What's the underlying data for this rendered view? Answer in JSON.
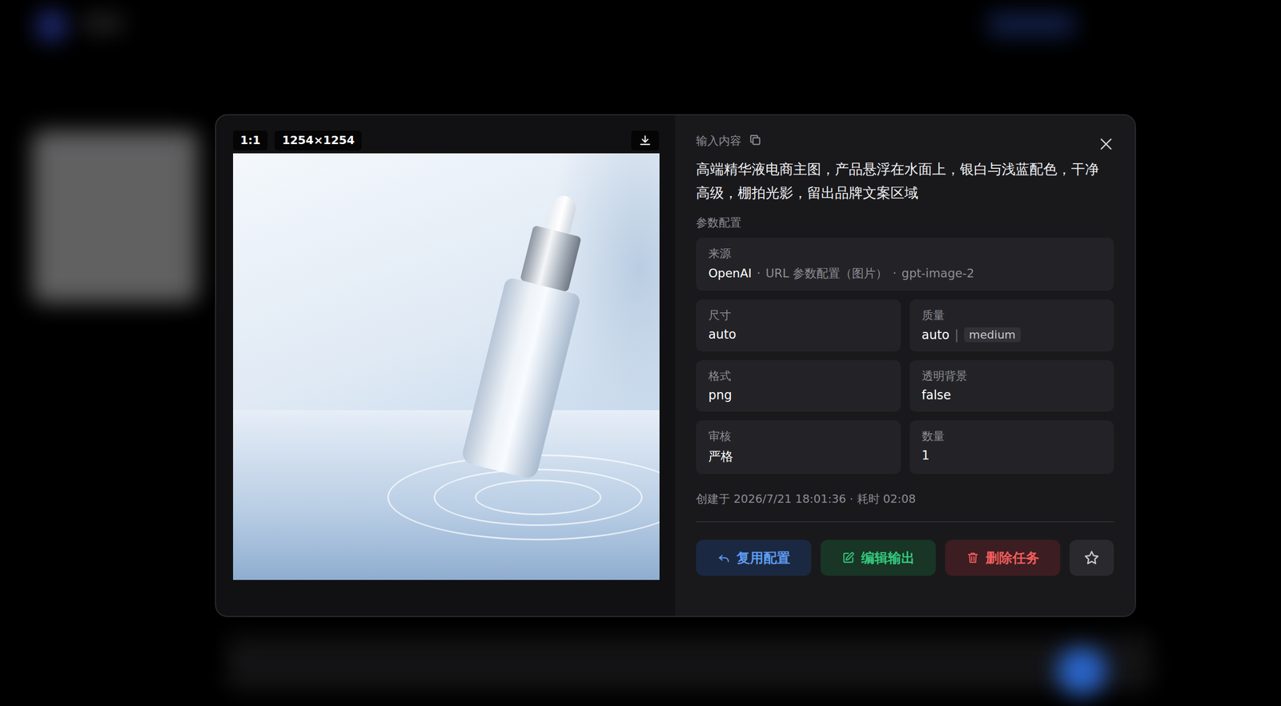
{
  "image": {
    "aspect": "1:1",
    "size": "1254×1254"
  },
  "prompt": {
    "label": "输入内容",
    "text": "高端精华液电商主图，产品悬浮在水面上，银白与浅蓝配色，干净高级，棚拍光影，留出品牌文案区域"
  },
  "params_label": "参数配置",
  "source": {
    "label": "来源",
    "parts": [
      "OpenAI",
      "·",
      "URL 参数配置（图片）",
      "·",
      "gpt-image-2"
    ]
  },
  "params": [
    {
      "label": "尺寸",
      "value": "auto"
    },
    {
      "label": "质量",
      "value": "auto",
      "separator": "|",
      "extra": "medium"
    },
    {
      "label": "格式",
      "value": "png"
    },
    {
      "label": "透明背景",
      "value": "false"
    },
    {
      "label": "审核",
      "value": "严格"
    },
    {
      "label": "数量",
      "value": "1"
    }
  ],
  "meta": "创建于 2026/7/21 18:01:36 · 耗时 02:08",
  "buttons": [
    {
      "label": "复用配置",
      "kind": "reuse"
    },
    {
      "label": "编辑输出",
      "kind": "edit"
    },
    {
      "label": "删除任务",
      "kind": "delete"
    }
  ],
  "favorite": {
    "selected": false
  }
}
